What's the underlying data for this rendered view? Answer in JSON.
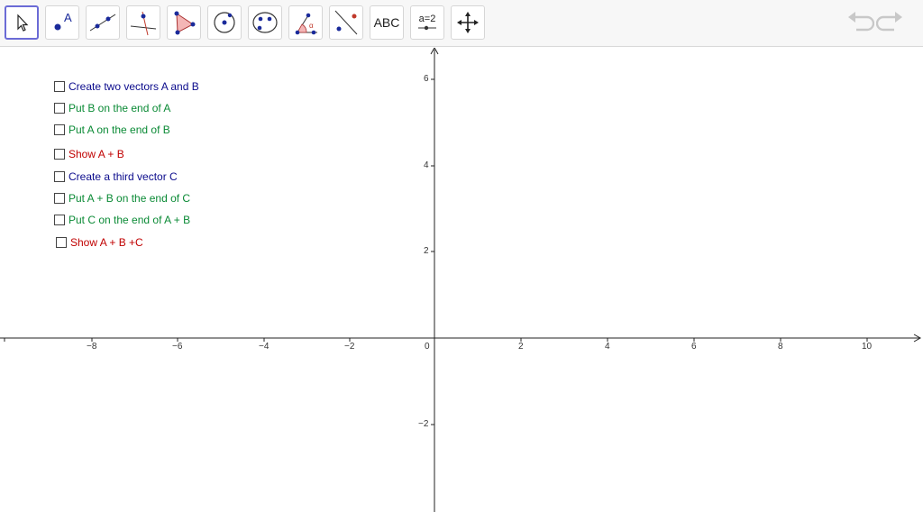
{
  "toolbar": {
    "tools": [
      {
        "name": "move-tool",
        "selected": true
      },
      {
        "name": "point-tool"
      },
      {
        "name": "line-tool"
      },
      {
        "name": "perpendicular-line-tool"
      },
      {
        "name": "polygon-tool"
      },
      {
        "name": "circle-tool"
      },
      {
        "name": "conic-tool"
      },
      {
        "name": "angle-tool"
      },
      {
        "name": "reflect-tool"
      },
      {
        "name": "text-tool",
        "label": "ABC"
      },
      {
        "name": "slider-tool",
        "label": "a=2"
      },
      {
        "name": "move-graphics-view-tool"
      }
    ],
    "undo_icon": "undo-icon",
    "redo_icon": "redo-icon"
  },
  "checkboxes": [
    {
      "label": "Create two vectors A and B",
      "color": "#0b0b8c",
      "checked": false
    },
    {
      "label": "Put B on the end of A",
      "color": "#0a8a35",
      "checked": false
    },
    {
      "label": "Put A on the end of B",
      "color": "#0a8a35",
      "checked": false
    },
    {
      "label": "Show A + B",
      "color": "#c00000",
      "checked": false
    },
    {
      "label": "Create a third vector C",
      "color": "#0b0b8c",
      "checked": false
    },
    {
      "label": "Put A + B on the end of C",
      "color": "#0a8a35",
      "checked": false
    },
    {
      "label": "Put C on the end of A + B",
      "color": "#0a8a35",
      "checked": false
    },
    {
      "label": "Show A + B +C",
      "color": "#c00000",
      "checked": false
    }
  ],
  "axes": {
    "x_ticks": [
      "−8",
      "−6",
      "−4",
      "−2",
      "0",
      "2",
      "4",
      "6",
      "8",
      "10"
    ],
    "y_ticks": [
      "6",
      "4",
      "2",
      "−2"
    ]
  }
}
